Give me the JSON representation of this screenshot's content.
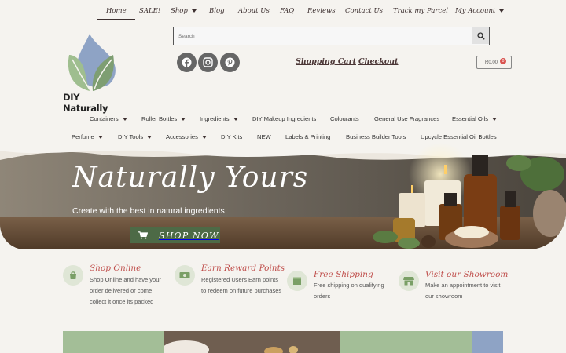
{
  "topnav": {
    "items": [
      {
        "label": "Home"
      },
      {
        "label": "SALE!"
      },
      {
        "label": "Shop"
      },
      {
        "label": "Blog"
      },
      {
        "label": "About Us"
      },
      {
        "label": "FAQ"
      },
      {
        "label": "Reviews"
      },
      {
        "label": "Contact Us"
      },
      {
        "label": "Track my Parcel"
      },
      {
        "label": "My Account"
      }
    ]
  },
  "logo": {
    "text": "DIY Naturally"
  },
  "search": {
    "placeholder": "Search"
  },
  "header": {
    "cart_label": "Shopping Cart",
    "checkout_label": "Checkout",
    "cart_total": "R0,00",
    "cart_count": "0"
  },
  "social": [
    "facebook-icon",
    "instagram-icon",
    "pinterest-icon"
  ],
  "catnav": {
    "row1": [
      "Containers",
      "Roller Bottles",
      "Ingredients",
      "DIY Makeup Ingredients",
      "Colourants",
      "General Use Fragrances",
      "Essential Oils"
    ],
    "row2": [
      "Perfume",
      "DIY Tools",
      "Accessories",
      "DIY Kits",
      "NEW",
      "Labels & Printing",
      "Business Builder Tools",
      "Upcycle Essential Oil Bottles"
    ]
  },
  "hero": {
    "title": "Naturally Yours",
    "subtitle": "Create with the best in natural ingredients",
    "button_label": "SHOP NOW"
  },
  "features": [
    {
      "title": "Shop Online",
      "text": "Shop Online and have your order delivered or come collect it once its packed",
      "icon": "bag-icon"
    },
    {
      "title": "Earn Reward Points",
      "text": "Registered Users Earn points to redeem on future purchases",
      "icon": "money-icon"
    },
    {
      "title": "Free Shipping",
      "text": "Free shipping on qualifying orders",
      "icon": "box-icon"
    },
    {
      "title": "Visit our Showroom",
      "text": "Make an appointment to visit our showroom",
      "icon": "store-icon"
    }
  ],
  "colors": {
    "accent": "#c0504d",
    "green": "#4d6a46",
    "sage": "#a3be97",
    "blue": "#8ea3c5"
  }
}
